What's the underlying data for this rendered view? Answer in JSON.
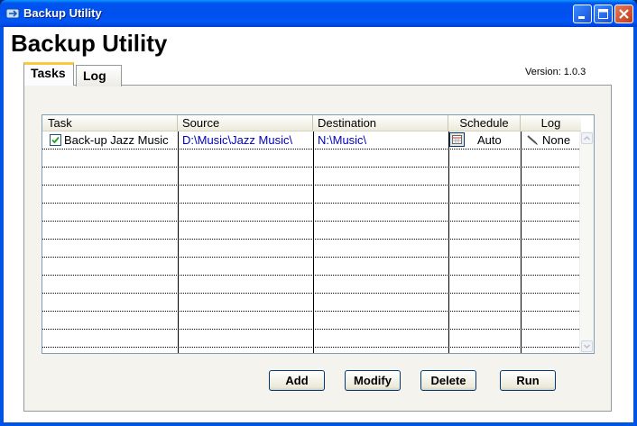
{
  "window": {
    "title": "Backup Utility",
    "heading": "Backup Utility"
  },
  "tabs": [
    {
      "label": "Tasks",
      "selected": true
    },
    {
      "label": "Log",
      "selected": false
    }
  ],
  "version": "Version: 1.0.3",
  "grid": {
    "columns": [
      "Task",
      "Source",
      "Destination",
      "Schedule",
      "Log"
    ],
    "rows": [
      {
        "checked": true,
        "task": "Back-up Jazz Music",
        "source": "D:\\Music\\Jazz Music\\",
        "destination": "N:\\Music\\",
        "schedule": "Auto",
        "log": "None"
      }
    ]
  },
  "buttons": {
    "add": "Add",
    "modify": "Modify",
    "delete": "Delete",
    "run": "Run"
  },
  "colors": {
    "titlebar": "#0054e3",
    "path_text": "#0000c0",
    "tab_highlight": "#ffc83c"
  },
  "icons": {
    "app": "backup-app-icon",
    "schedule": "calendar-icon",
    "log": "pen-icon"
  }
}
